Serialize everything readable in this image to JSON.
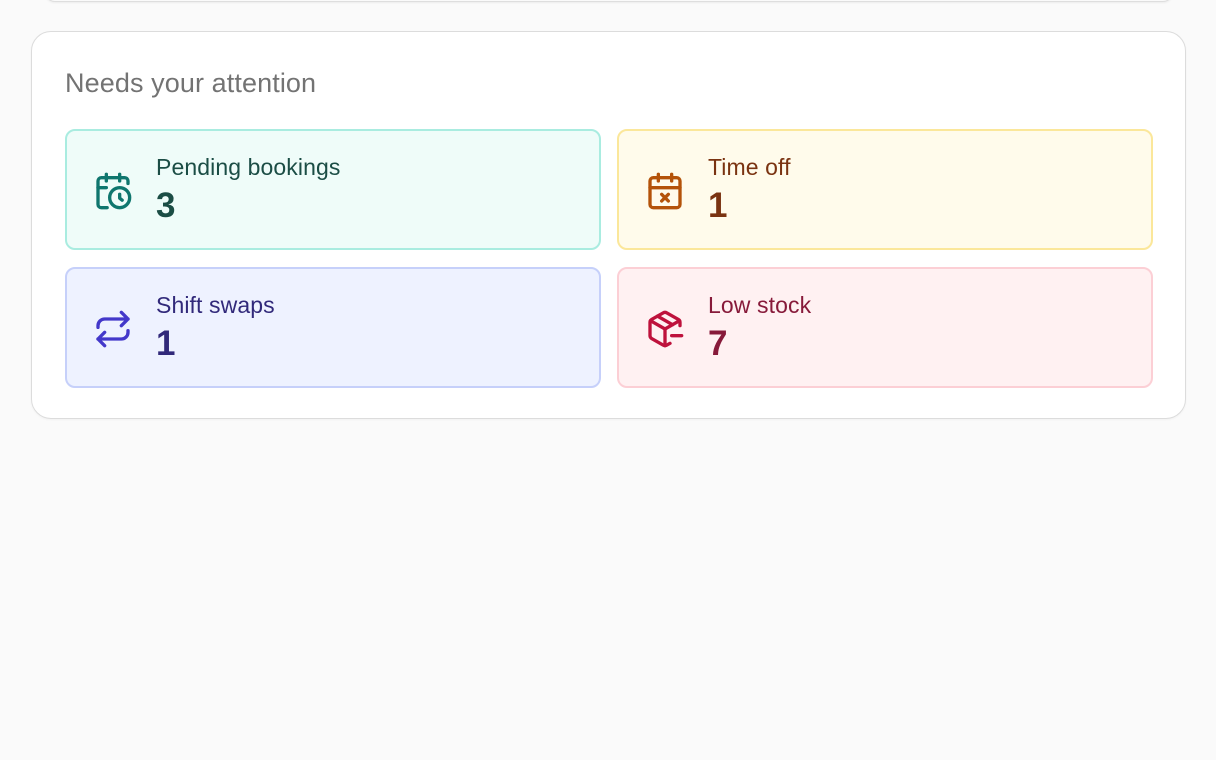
{
  "attention": {
    "title": "Needs your attention",
    "tiles": [
      {
        "label": "Pending bookings",
        "count": "3",
        "icon": "calendar-clock-icon",
        "color": "#0f766e"
      },
      {
        "label": "Time off",
        "count": "1",
        "icon": "calendar-x-icon",
        "color": "#b45309"
      },
      {
        "label": "Shift swaps",
        "count": "1",
        "icon": "repeat-icon",
        "color": "#4338ca"
      },
      {
        "label": "Low stock",
        "count": "7",
        "icon": "package-minus-icon",
        "color": "#be123c"
      }
    ]
  }
}
